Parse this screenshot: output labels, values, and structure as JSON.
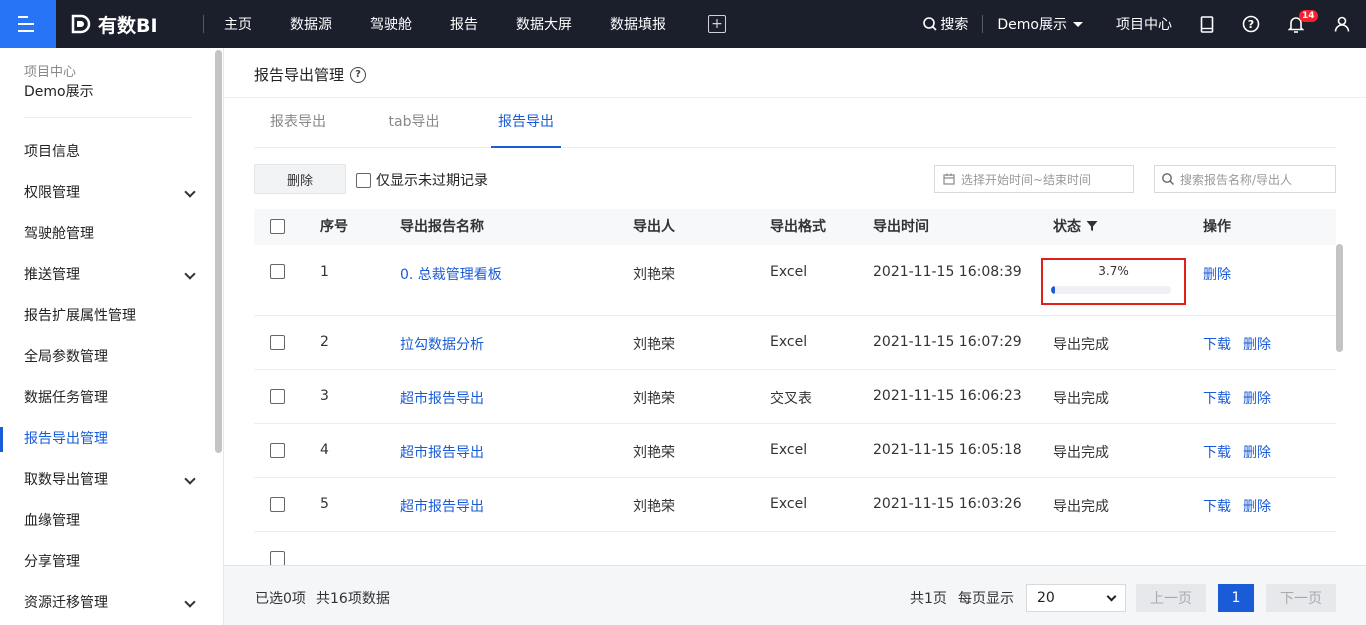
{
  "topbar": {
    "logo_text": "有数BI",
    "nav": [
      "主页",
      "数据源",
      "驾驶舱",
      "报告",
      "数据大屏",
      "数据填报"
    ],
    "search_label": "搜索",
    "project_label": "Demo展示",
    "project_center_label": "项目中心",
    "notification_count": "14",
    "accent_color": "#2775f6"
  },
  "sidebar": {
    "crumb": "项目中心",
    "project": "Demo展示",
    "items": [
      {
        "label": "项目信息",
        "expandable": false
      },
      {
        "label": "权限管理",
        "expandable": true
      },
      {
        "label": "驾驶舱管理",
        "expandable": false
      },
      {
        "label": "推送管理",
        "expandable": true
      },
      {
        "label": "报告扩展属性管理",
        "expandable": false
      },
      {
        "label": "全局参数管理",
        "expandable": false
      },
      {
        "label": "数据任务管理",
        "expandable": false
      },
      {
        "label": "报告导出管理",
        "expandable": false,
        "active": true
      },
      {
        "label": "取数导出管理",
        "expandable": true
      },
      {
        "label": "血缘管理",
        "expandable": false
      },
      {
        "label": "分享管理",
        "expandable": false
      },
      {
        "label": "资源迁移管理",
        "expandable": true
      }
    ]
  },
  "main": {
    "title": "报告导出管理",
    "tabs": [
      "报表导出",
      "tab导出",
      "报告导出"
    ],
    "active_tab": "报告导出",
    "delete_label": "删除",
    "filter_label": "仅显示未过期记录",
    "date_placeholder": "选择开始时间~结束时间",
    "search_placeholder": "搜索报告名称/导出人"
  },
  "table": {
    "columns": [
      "序号",
      "导出报告名称",
      "导出人",
      "导出格式",
      "导出时间",
      "状态",
      "操作"
    ],
    "rows": [
      {
        "no": "1",
        "name": "0. 总裁管理看板",
        "user": "刘艳荣",
        "format": "Excel",
        "time": "2021-11-15 16:08:39",
        "status": "",
        "progress_label": "3.7%",
        "progress": 0.037,
        "actions": [
          "删除"
        ]
      },
      {
        "no": "2",
        "name": "拉勾数据分析",
        "user": "刘艳荣",
        "format": "Excel",
        "time": "2021-11-15 16:07:29",
        "status": "导出完成",
        "actions": [
          "下载",
          "删除"
        ]
      },
      {
        "no": "3",
        "name": "超市报告导出",
        "user": "刘艳荣",
        "format": "交叉表",
        "time": "2021-11-15 16:06:23",
        "status": "导出完成",
        "actions": [
          "下载",
          "删除"
        ]
      },
      {
        "no": "4",
        "name": "超市报告导出",
        "user": "刘艳荣",
        "format": "Excel",
        "time": "2021-11-15 16:05:18",
        "status": "导出完成",
        "actions": [
          "下载",
          "删除"
        ]
      },
      {
        "no": "5",
        "name": "超市报告导出",
        "user": "刘艳荣",
        "format": "Excel",
        "time": "2021-11-15 16:03:26",
        "status": "导出完成",
        "actions": [
          "下载",
          "删除"
        ]
      }
    ]
  },
  "footer": {
    "selected": "已选0项",
    "total": "共16项数据",
    "pages": "共1页",
    "per_page_label": "每页显示",
    "per_page_value": "20",
    "prev_label": "上一页",
    "current_page": "1",
    "next_label": "下一页"
  }
}
